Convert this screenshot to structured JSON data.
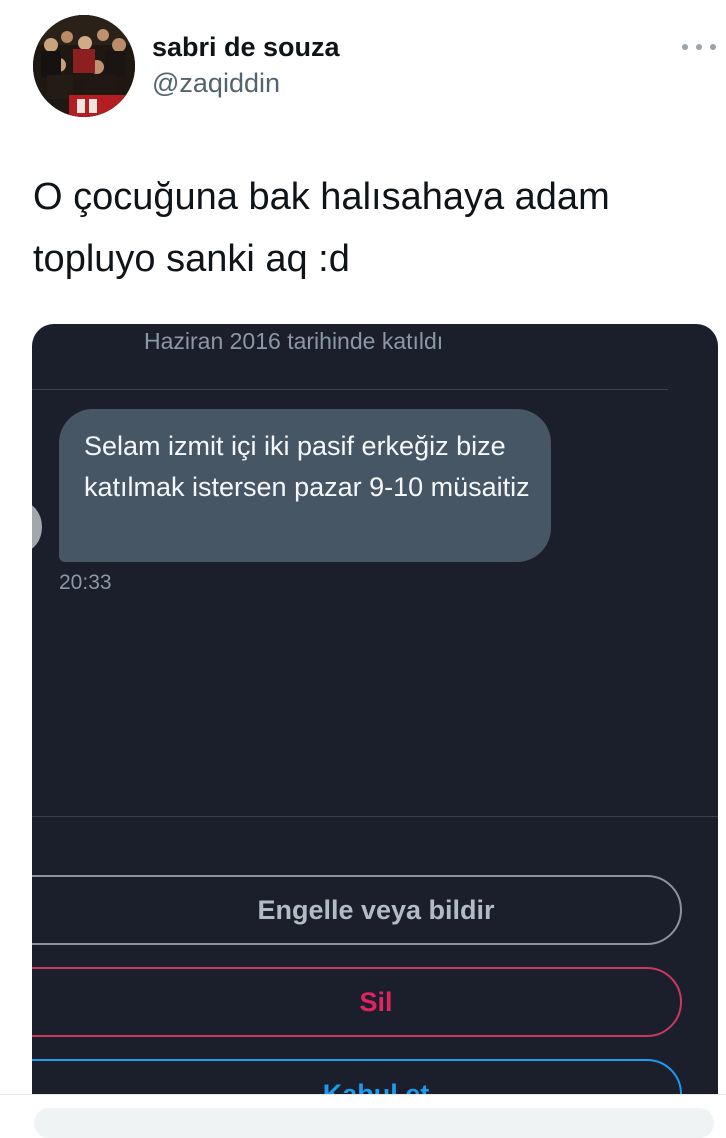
{
  "tweet": {
    "author_name": "sabri de souza",
    "author_handle": "@zaqiddin",
    "text": "O çocuğuna bak halısahaya adam topluyo sanki aq :d",
    "more_icon": "ellipsis-icon"
  },
  "embedded_dm": {
    "joined_text": "Haziran 2016 tarihinde katıldı",
    "message": {
      "text": "Selam izmit içi iki pasif erkeğiz bize katılmak istersen pazar 9-10 müsaitiz",
      "time": "20:33"
    },
    "buttons": {
      "block_report": "Engelle veya bildir",
      "delete": "Sil",
      "accept": "Kabul et"
    },
    "colors": {
      "background": "#1b1f2b",
      "bubble": "#475665",
      "delete": "#e0245e",
      "accept": "#1d9bf0"
    }
  }
}
